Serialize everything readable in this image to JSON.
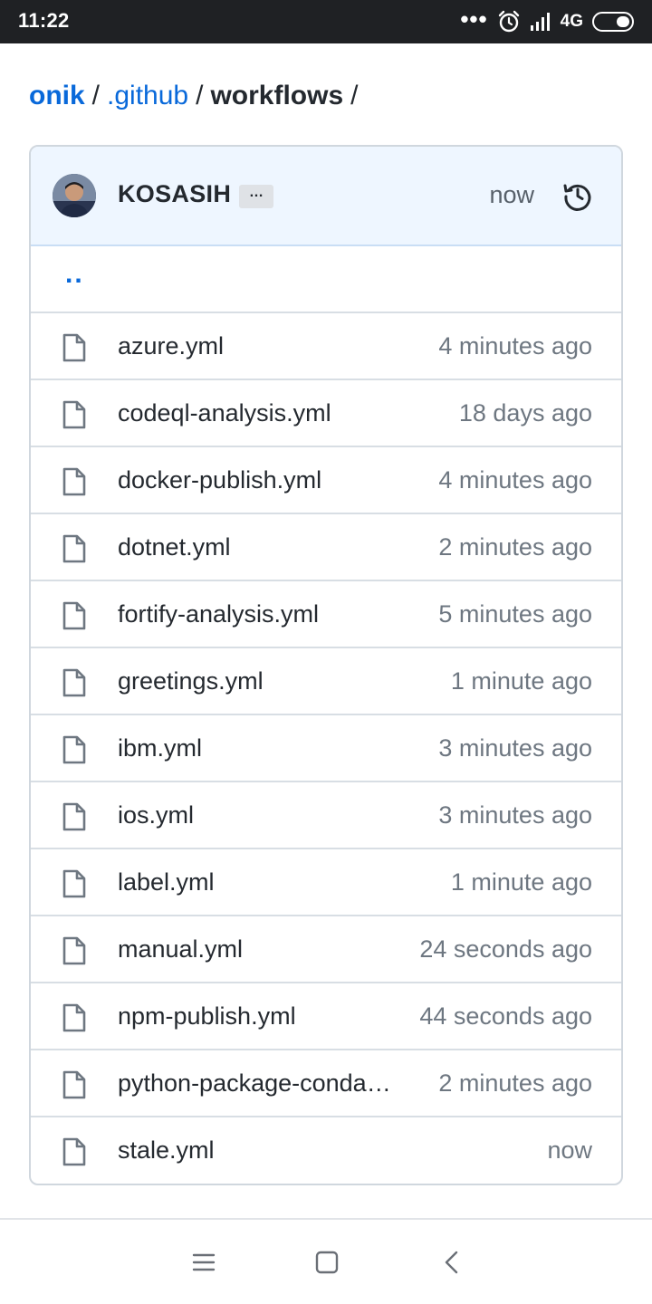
{
  "status_bar": {
    "time": "11:22",
    "network": "4G"
  },
  "breadcrumb": {
    "owner": "onik",
    "folder": ".github",
    "current": "workflows",
    "separator": "/"
  },
  "commit": {
    "author": "KOSASIH",
    "ellipsis": "…",
    "time": "now"
  },
  "parent_dir": "..",
  "files": [
    {
      "name": "azure.yml",
      "age": "4 minutes ago"
    },
    {
      "name": "codeql-analysis.yml",
      "age": "18 days ago"
    },
    {
      "name": "docker-publish.yml",
      "age": "4 minutes ago"
    },
    {
      "name": "dotnet.yml",
      "age": "2 minutes ago"
    },
    {
      "name": "fortify-analysis.yml",
      "age": "5 minutes ago"
    },
    {
      "name": "greetings.yml",
      "age": "1 minute ago"
    },
    {
      "name": "ibm.yml",
      "age": "3 minutes ago"
    },
    {
      "name": "ios.yml",
      "age": "3 minutes ago"
    },
    {
      "name": "label.yml",
      "age": "1 minute ago"
    },
    {
      "name": "manual.yml",
      "age": "24 seconds ago"
    },
    {
      "name": "npm-publish.yml",
      "age": "44 seconds ago"
    },
    {
      "name": "python-package-conda.yml",
      "age": "2 minutes ago"
    },
    {
      "name": "stale.yml",
      "age": "now"
    }
  ],
  "colors": {
    "link": "#0969da",
    "commit_bar": "#eef6ff",
    "border": "#d0d7de"
  },
  "icons": {
    "history": "history-icon",
    "file": "file-icon",
    "menu": "menu-icon",
    "home": "home-icon",
    "back": "back-icon"
  }
}
